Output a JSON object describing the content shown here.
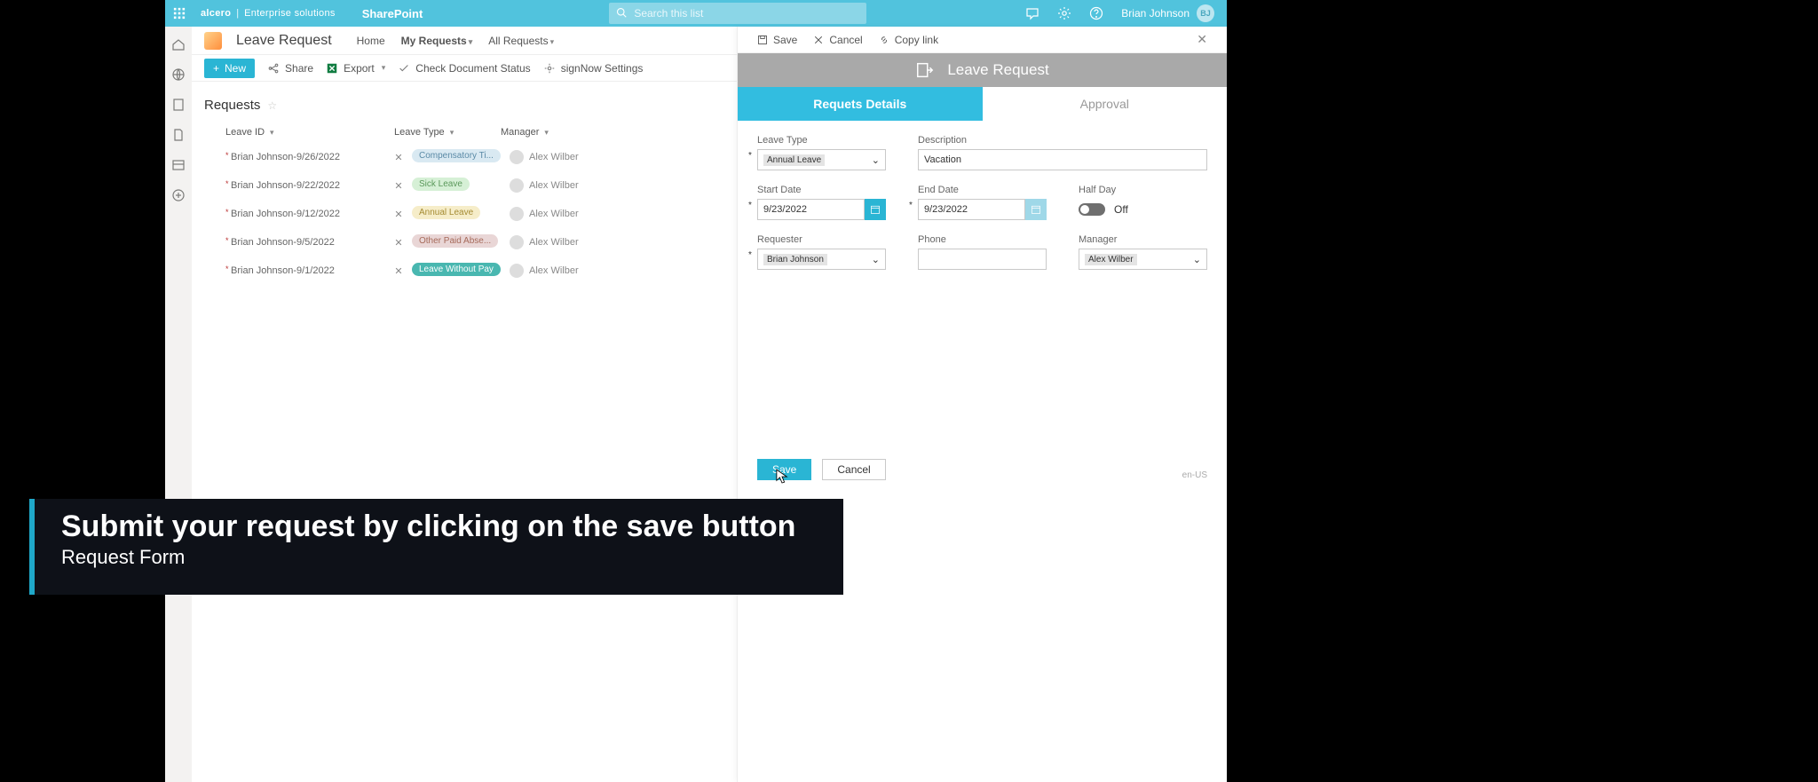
{
  "topbar": {
    "tenant": "Enterprise solutions",
    "logo": "alcero",
    "app": "SharePoint",
    "search_placeholder": "Search this list",
    "user_name": "Brian Johnson",
    "user_initials": "BJ"
  },
  "subheader": {
    "title": "Leave Request",
    "nav": {
      "home": "Home",
      "my_requests": "My Requests",
      "all_requests": "All Requests"
    }
  },
  "toolbar": {
    "new": "New",
    "share": "Share",
    "export": "Export",
    "check_doc": "Check Document Status",
    "signnow": "signNow Settings"
  },
  "list": {
    "title": "Requests",
    "columns": {
      "leave_id": "Leave ID",
      "leave_type": "Leave Type",
      "manager": "Manager"
    },
    "rows": [
      {
        "id": "Brian Johnson-9/26/2022",
        "type": "Compensatory Ti...",
        "type_style": "pill-comp",
        "manager": "Alex Wilber"
      },
      {
        "id": "Brian Johnson-9/22/2022",
        "type": "Sick Leave",
        "type_style": "pill-sick",
        "manager": "Alex Wilber"
      },
      {
        "id": "Brian Johnson-9/12/2022",
        "type": "Annual Leave",
        "type_style": "pill-annual",
        "manager": "Alex Wilber"
      },
      {
        "id": "Brian Johnson-9/5/2022",
        "type": "Other Paid Abse...",
        "type_style": "pill-other",
        "manager": "Alex Wilber"
      },
      {
        "id": "Brian Johnson-9/1/2022",
        "type": "Leave Without Pay",
        "type_style": "pill-lwp",
        "manager": "Alex Wilber"
      }
    ]
  },
  "panel": {
    "actions": {
      "save": "Save",
      "cancel": "Cancel",
      "copylink": "Copy link"
    },
    "title": "Leave Request",
    "tabs": {
      "details": "Requets Details",
      "approval": "Approval"
    },
    "form": {
      "leave_type_label": "Leave Type",
      "leave_type_value": "Annual Leave",
      "description_label": "Description",
      "description_value": "Vacation",
      "start_date_label": "Start Date",
      "start_date_value": "9/23/2022",
      "end_date_label": "End Date",
      "end_date_value": "9/23/2022",
      "half_day_label": "Half Day",
      "half_day_value": "Off",
      "requester_label": "Requester",
      "requester_value": "Brian Johnson",
      "phone_label": "Phone",
      "phone_value": "",
      "manager_label": "Manager",
      "manager_value": "Alex Wilber"
    },
    "footer": {
      "save": "Save",
      "cancel": "Cancel"
    },
    "locale": "en-US"
  },
  "caption": {
    "title": "Submit your request by clicking on the save button",
    "sub": "Request Form"
  }
}
